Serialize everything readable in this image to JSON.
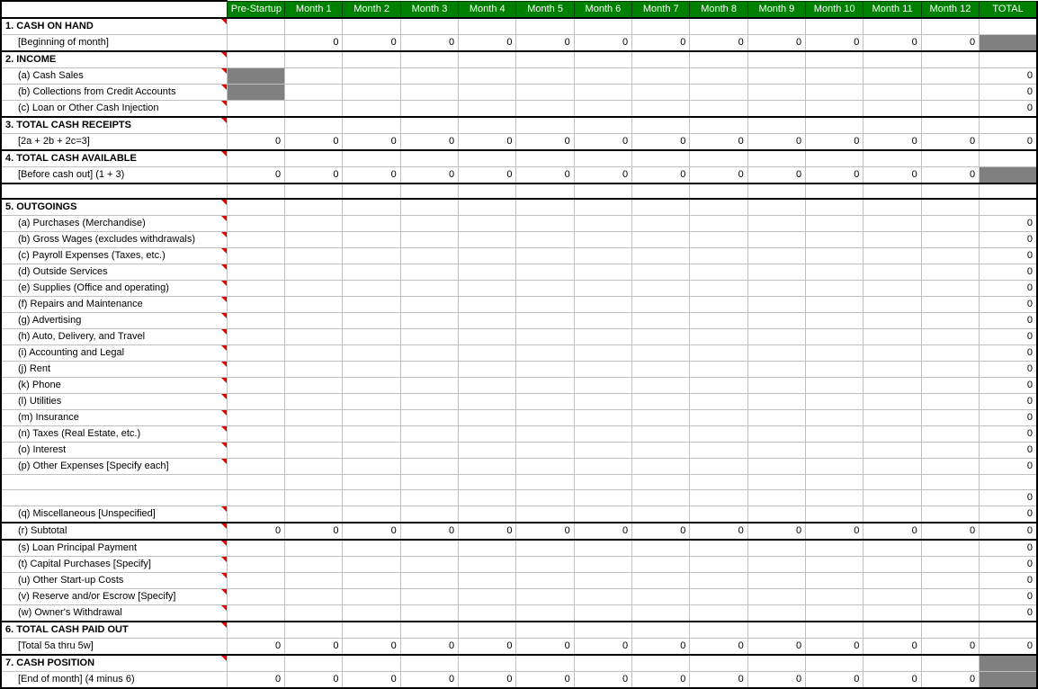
{
  "headers": {
    "label": "",
    "prestart": "Pre-Startup",
    "months": [
      "Month 1",
      "Month 2",
      "Month 3",
      "Month 4",
      "Month 5",
      "Month 6",
      "Month 7",
      "Month 8",
      "Month 9",
      "Month 10",
      "Month 11",
      "Month 12"
    ],
    "total": "TOTAL"
  },
  "rows": [
    {
      "id": "r1",
      "label": "1. CASH ON HAND",
      "bold": true,
      "indent": false,
      "comment": true,
      "topBlack": true,
      "cells": [
        "",
        "",
        "",
        "",
        "",
        "",
        "",
        "",
        "",
        "",
        "",
        "",
        ""
      ],
      "total": ""
    },
    {
      "id": "r1a",
      "label": "[Beginning of month]",
      "bold": false,
      "indent": true,
      "botBlack": true,
      "cells": [
        "",
        "0",
        "0",
        "0",
        "0",
        "0",
        "0",
        "0",
        "0",
        "0",
        "0",
        "0",
        "0"
      ],
      "total": "",
      "totalGray": true
    },
    {
      "id": "r2",
      "label": "2. INCOME",
      "bold": true,
      "indent": false,
      "comment": true,
      "cells": [
        "",
        "",
        "",
        "",
        "",
        "",
        "",
        "",
        "",
        "",
        "",
        "",
        ""
      ],
      "total": ""
    },
    {
      "id": "r2a",
      "label": "(a) Cash Sales",
      "bold": false,
      "indent": true,
      "comment": true,
      "prestartGray": true,
      "cells": [
        "",
        "",
        "",
        "",
        "",
        "",
        "",
        "",
        "",
        "",
        "",
        "",
        ""
      ],
      "total": "0"
    },
    {
      "id": "r2b",
      "label": "(b) Collections from Credit Accounts",
      "bold": false,
      "indent": true,
      "comment": true,
      "prestartGray": true,
      "cells": [
        "",
        "",
        "",
        "",
        "",
        "",
        "",
        "",
        "",
        "",
        "",
        "",
        ""
      ],
      "total": "0"
    },
    {
      "id": "r2c",
      "label": "(c) Loan or Other Cash Injection",
      "bold": false,
      "indent": true,
      "comment": true,
      "cells": [
        "",
        "",
        "",
        "",
        "",
        "",
        "",
        "",
        "",
        "",
        "",
        "",
        ""
      ],
      "total": "0"
    },
    {
      "id": "r3",
      "label": "3. TOTAL CASH RECEIPTS",
      "bold": true,
      "indent": false,
      "comment": true,
      "topBlack": true,
      "cells": [
        "",
        "",
        "",
        "",
        "",
        "",
        "",
        "",
        "",
        "",
        "",
        "",
        ""
      ],
      "total": ""
    },
    {
      "id": "r3a",
      "label": "[2a + 2b + 2c=3]",
      "bold": false,
      "indent": true,
      "botBlack": true,
      "cells": [
        "0",
        "0",
        "0",
        "0",
        "0",
        "0",
        "0",
        "0",
        "0",
        "0",
        "0",
        "0",
        "0"
      ],
      "total": "0"
    },
    {
      "id": "r4",
      "label": "4. TOTAL CASH AVAILABLE",
      "bold": true,
      "indent": false,
      "comment": true,
      "cells": [
        "",
        "",
        "",
        "",
        "",
        "",
        "",
        "",
        "",
        "",
        "",
        "",
        ""
      ],
      "total": ""
    },
    {
      "id": "r4a",
      "label": "[Before cash out] (1 + 3)",
      "bold": false,
      "indent": true,
      "botBlack": true,
      "cells": [
        "0",
        "0",
        "0",
        "0",
        "0",
        "0",
        "0",
        "0",
        "0",
        "0",
        "0",
        "0",
        "0"
      ],
      "total": "",
      "totalGray": true
    },
    {
      "id": "rsp1",
      "label": "",
      "spacer": true,
      "cells": [
        "",
        "",
        "",
        "",
        "",
        "",
        "",
        "",
        "",
        "",
        "",
        "",
        ""
      ],
      "total": ""
    },
    {
      "id": "r5",
      "label": "5. OUTGOINGS",
      "bold": true,
      "indent": false,
      "comment": true,
      "topBlack": true,
      "cells": [
        "",
        "",
        "",
        "",
        "",
        "",
        "",
        "",
        "",
        "",
        "",
        "",
        ""
      ],
      "total": ""
    },
    {
      "id": "r5a",
      "label": "(a) Purchases (Merchandise)",
      "bold": false,
      "indent": true,
      "comment": true,
      "cells": [
        "",
        "",
        "",
        "",
        "",
        "",
        "",
        "",
        "",
        "",
        "",
        "",
        ""
      ],
      "total": "0"
    },
    {
      "id": "r5b",
      "label": "(b) Gross Wages (excludes withdrawals)",
      "bold": false,
      "indent": true,
      "comment": true,
      "cells": [
        "",
        "",
        "",
        "",
        "",
        "",
        "",
        "",
        "",
        "",
        "",
        "",
        ""
      ],
      "total": "0"
    },
    {
      "id": "r5c",
      "label": "(c) Payroll Expenses (Taxes, etc.)",
      "bold": false,
      "indent": true,
      "comment": true,
      "cells": [
        "",
        "",
        "",
        "",
        "",
        "",
        "",
        "",
        "",
        "",
        "",
        "",
        ""
      ],
      "total": "0"
    },
    {
      "id": "r5d",
      "label": "(d) Outside Services",
      "bold": false,
      "indent": true,
      "comment": true,
      "cells": [
        "",
        "",
        "",
        "",
        "",
        "",
        "",
        "",
        "",
        "",
        "",
        "",
        ""
      ],
      "total": "0"
    },
    {
      "id": "r5e",
      "label": "(e) Supplies (Office and operating)",
      "bold": false,
      "indent": true,
      "comment": true,
      "cells": [
        "",
        "",
        "",
        "",
        "",
        "",
        "",
        "",
        "",
        "",
        "",
        "",
        ""
      ],
      "total": "0"
    },
    {
      "id": "r5f",
      "label": "(f) Repairs and Maintenance",
      "bold": false,
      "indent": true,
      "comment": true,
      "cells": [
        "",
        "",
        "",
        "",
        "",
        "",
        "",
        "",
        "",
        "",
        "",
        "",
        ""
      ],
      "total": "0"
    },
    {
      "id": "r5g",
      "label": "(g) Advertising",
      "bold": false,
      "indent": true,
      "comment": true,
      "cells": [
        "",
        "",
        "",
        "",
        "",
        "",
        "",
        "",
        "",
        "",
        "",
        "",
        ""
      ],
      "total": "0"
    },
    {
      "id": "r5h",
      "label": "(h) Auto, Delivery, and Travel",
      "bold": false,
      "indent": true,
      "comment": true,
      "cells": [
        "",
        "",
        "",
        "",
        "",
        "",
        "",
        "",
        "",
        "",
        "",
        "",
        ""
      ],
      "total": "0"
    },
    {
      "id": "r5i",
      "label": "(i) Accounting and Legal",
      "bold": false,
      "indent": true,
      "comment": true,
      "cells": [
        "",
        "",
        "",
        "",
        "",
        "",
        "",
        "",
        "",
        "",
        "",
        "",
        ""
      ],
      "total": "0"
    },
    {
      "id": "r5j",
      "label": "(j) Rent",
      "bold": false,
      "indent": true,
      "comment": true,
      "cells": [
        "",
        "",
        "",
        "",
        "",
        "",
        "",
        "",
        "",
        "",
        "",
        "",
        ""
      ],
      "total": "0"
    },
    {
      "id": "r5k",
      "label": "(k) Phone",
      "bold": false,
      "indent": true,
      "comment": true,
      "cells": [
        "",
        "",
        "",
        "",
        "",
        "",
        "",
        "",
        "",
        "",
        "",
        "",
        ""
      ],
      "total": "0"
    },
    {
      "id": "r5l",
      "label": "(l) Utilities",
      "bold": false,
      "indent": true,
      "comment": true,
      "cells": [
        "",
        "",
        "",
        "",
        "",
        "",
        "",
        "",
        "",
        "",
        "",
        "",
        ""
      ],
      "total": "0"
    },
    {
      "id": "r5m",
      "label": "(m) Insurance",
      "bold": false,
      "indent": true,
      "comment": true,
      "cells": [
        "",
        "",
        "",
        "",
        "",
        "",
        "",
        "",
        "",
        "",
        "",
        "",
        ""
      ],
      "total": "0"
    },
    {
      "id": "r5n",
      "label": "(n) Taxes (Real Estate, etc.)",
      "bold": false,
      "indent": true,
      "comment": true,
      "cells": [
        "",
        "",
        "",
        "",
        "",
        "",
        "",
        "",
        "",
        "",
        "",
        "",
        ""
      ],
      "total": "0"
    },
    {
      "id": "r5o",
      "label": "(o) Interest",
      "bold": false,
      "indent": true,
      "comment": true,
      "cells": [
        "",
        "",
        "",
        "",
        "",
        "",
        "",
        "",
        "",
        "",
        "",
        "",
        ""
      ],
      "total": "0"
    },
    {
      "id": "r5p",
      "label": "(p) Other Expenses [Specify each]",
      "bold": false,
      "indent": true,
      "comment": true,
      "cells": [
        "",
        "",
        "",
        "",
        "",
        "",
        "",
        "",
        "",
        "",
        "",
        "",
        ""
      ],
      "total": "0"
    },
    {
      "id": "rsp2",
      "label": "",
      "indent": true,
      "cells": [
        "",
        "",
        "",
        "",
        "",
        "",
        "",
        "",
        "",
        "",
        "",
        "",
        ""
      ],
      "total": ""
    },
    {
      "id": "rsp3",
      "label": "",
      "indent": true,
      "cells": [
        "",
        "",
        "",
        "",
        "",
        "",
        "",
        "",
        "",
        "",
        "",
        "",
        ""
      ],
      "total": "0"
    },
    {
      "id": "r5q",
      "label": "(q) Miscellaneous [Unspecified]",
      "bold": false,
      "indent": true,
      "comment": true,
      "cells": [
        "",
        "",
        "",
        "",
        "",
        "",
        "",
        "",
        "",
        "",
        "",
        "",
        ""
      ],
      "total": "0"
    },
    {
      "id": "r5r",
      "label": "(r) Subtotal",
      "bold": false,
      "indent": true,
      "comment": true,
      "topBlack": true,
      "botBlack": true,
      "cells": [
        "0",
        "0",
        "0",
        "0",
        "0",
        "0",
        "0",
        "0",
        "0",
        "0",
        "0",
        "0",
        "0"
      ],
      "total": "0"
    },
    {
      "id": "r5s",
      "label": "(s) Loan Principal Payment",
      "bold": false,
      "indent": true,
      "comment": true,
      "cells": [
        "",
        "",
        "",
        "",
        "",
        "",
        "",
        "",
        "",
        "",
        "",
        "",
        ""
      ],
      "total": "0"
    },
    {
      "id": "r5t",
      "label": "(t) Capital Purchases [Specify]",
      "bold": false,
      "indent": true,
      "comment": true,
      "cells": [
        "",
        "",
        "",
        "",
        "",
        "",
        "",
        "",
        "",
        "",
        "",
        "",
        ""
      ],
      "total": "0"
    },
    {
      "id": "r5u",
      "label": "(u) Other Start-up Costs",
      "bold": false,
      "indent": true,
      "comment": true,
      "cells": [
        "",
        "",
        "",
        "",
        "",
        "",
        "",
        "",
        "",
        "",
        "",
        "",
        ""
      ],
      "total": "0"
    },
    {
      "id": "r5v",
      "label": "(v) Reserve and/or Escrow [Specify]",
      "bold": false,
      "indent": true,
      "comment": true,
      "cells": [
        "",
        "",
        "",
        "",
        "",
        "",
        "",
        "",
        "",
        "",
        "",
        "",
        ""
      ],
      "total": "0"
    },
    {
      "id": "r5w",
      "label": "(w) Owner's Withdrawal",
      "bold": false,
      "indent": true,
      "comment": true,
      "cells": [
        "",
        "",
        "",
        "",
        "",
        "",
        "",
        "",
        "",
        "",
        "",
        "",
        ""
      ],
      "total": "0"
    },
    {
      "id": "r6",
      "label": "6. TOTAL CASH PAID OUT",
      "bold": true,
      "indent": false,
      "comment": true,
      "topBlack": true,
      "cells": [
        "",
        "",
        "",
        "",
        "",
        "",
        "",
        "",
        "",
        "",
        "",
        "",
        ""
      ],
      "total": ""
    },
    {
      "id": "r6a",
      "label": "[Total 5a thru 5w]",
      "bold": false,
      "indent": true,
      "botBlack": true,
      "cells": [
        "0",
        "0",
        "0",
        "0",
        "0",
        "0",
        "0",
        "0",
        "0",
        "0",
        "0",
        "0",
        "0"
      ],
      "total": "0"
    },
    {
      "id": "r7",
      "label": "7. CASH POSITION",
      "bold": true,
      "indent": false,
      "comment": true,
      "cells": [
        "",
        "",
        "",
        "",
        "",
        "",
        "",
        "",
        "",
        "",
        "",
        "",
        ""
      ],
      "total": "",
      "totalGray": true
    },
    {
      "id": "r7a",
      "label": "[End of month]  (4 minus 6)",
      "bold": false,
      "indent": true,
      "botBlack": true,
      "cells": [
        "0",
        "0",
        "0",
        "0",
        "0",
        "0",
        "0",
        "0",
        "0",
        "0",
        "0",
        "0",
        "0"
      ],
      "total": "",
      "totalGray": true
    }
  ]
}
